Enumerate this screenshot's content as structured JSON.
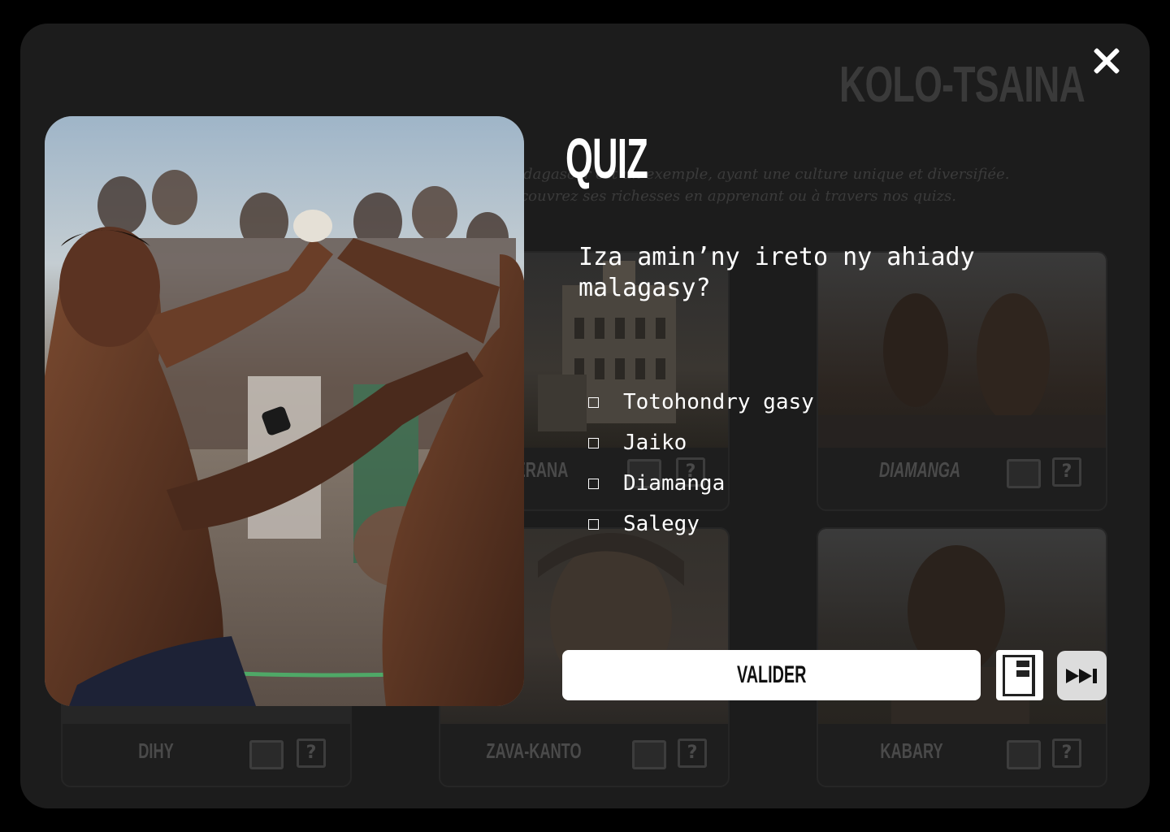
{
  "background_page": {
    "title": "KOLO-TSAINA",
    "intro_line1": "Madagascar est un exemple, ayant une culture unique et diversifiée.",
    "intro_line2": "Découvrez ses richesses en apprenant ou à travers nos quizs.",
    "cards": [
      {
        "name": "ANTANANARIVO ERANA",
        "visible_name": "ERANA"
      },
      {
        "name": "DIAMANGA"
      },
      {
        "name": "DIHY"
      },
      {
        "name": "ZAVA-KANTO"
      },
      {
        "name": "KABARY"
      }
    ]
  },
  "modal": {
    "title": "QUIZ",
    "question": "Iza amin’ny ireto ny ahiady malagasy?",
    "options": [
      "Totohondry gasy",
      "Jaiko",
      "Diamanga",
      "Salegy"
    ],
    "validate_label": "VALIDER",
    "icons": {
      "close": "close-icon",
      "book": "book-icon",
      "skip": "skip-forward-icon"
    }
  },
  "colors": {
    "panel": "#1c1c1c",
    "text": "#ffffff",
    "button_bg": "#ffffff",
    "skip_bg": "#dcdcdc"
  }
}
